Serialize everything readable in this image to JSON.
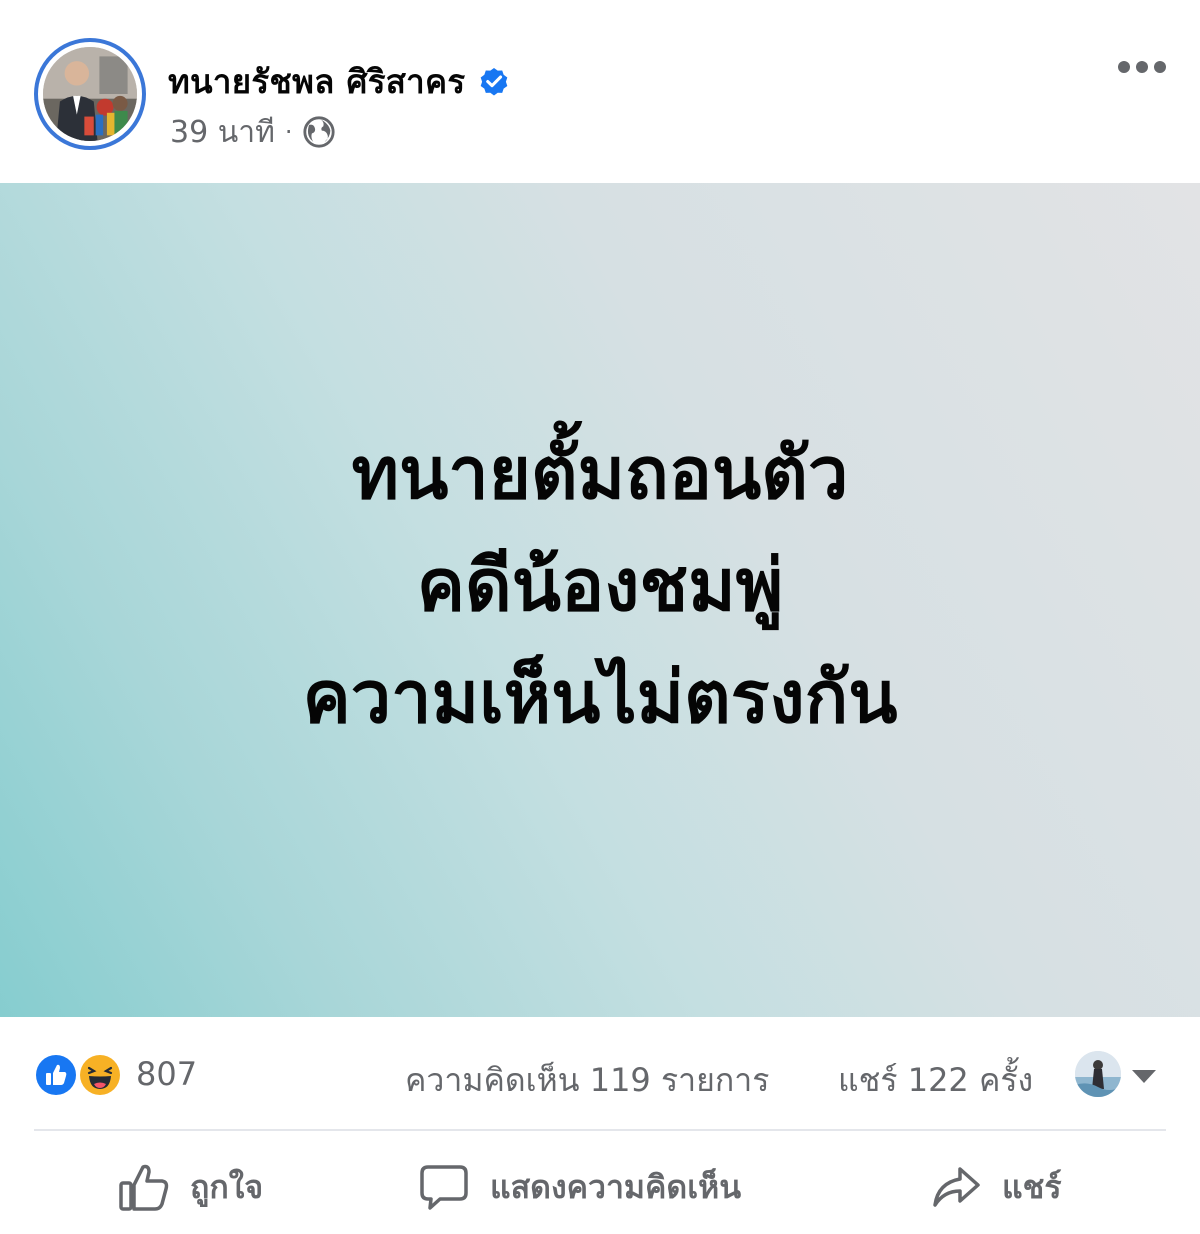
{
  "post": {
    "author_name": "ทนายรัชพล ศิริสาคร",
    "time": "39 นาที",
    "separator": "·",
    "text_lines": [
      "ทนายตั้มถอนตัว",
      "คดีน้องชมพู่",
      "ความเห็นไม่ตรงกัน"
    ]
  },
  "reactions": {
    "count": "807",
    "comments": "ความคิดเห็น 119 รายการ",
    "shares": "แชร์ 122 ครั้ง"
  },
  "actions": {
    "like_label": "ถูกใจ",
    "comment_label": "แสดงความคิดเห็น",
    "share_label": "แชร์"
  },
  "icons": {
    "verified": "verified-badge-icon",
    "audience": "globe-icon",
    "more": "more-options-icon",
    "like_reaction": "like-reaction-icon",
    "haha_reaction": "haha-reaction-icon",
    "like": "thumbs-up-icon",
    "comment": "comment-bubble-icon",
    "share": "share-arrow-icon",
    "caret": "caret-down-icon"
  },
  "colors": {
    "brand_blue": "#1877f2",
    "text_primary": "#050505",
    "text_secondary": "#65676b",
    "haha_yellow": "#f7b125",
    "card_gradient_start": "#86cdcf",
    "card_gradient_end": "#e2e3e5"
  }
}
